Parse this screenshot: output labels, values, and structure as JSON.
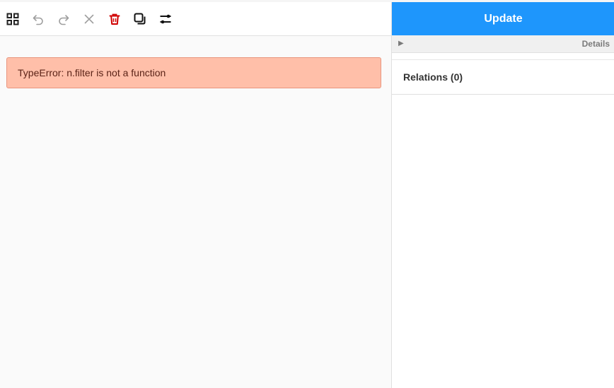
{
  "toolbar": {
    "buttons": [
      {
        "name": "grid-view-icon",
        "color": "#222222"
      },
      {
        "name": "undo-icon",
        "color": "#9e9e9e"
      },
      {
        "name": "redo-icon",
        "color": "#9e9e9e"
      },
      {
        "name": "close-icon",
        "color": "#9e9e9e"
      },
      {
        "name": "delete-icon",
        "color": "#d00000"
      },
      {
        "name": "copy-icon",
        "color": "#111111"
      },
      {
        "name": "toggle-settings-icon",
        "color": "#111111"
      }
    ]
  },
  "main": {
    "error_message": "TypeError: n.filter is not a function"
  },
  "sidebar": {
    "update_label": "Update",
    "details_arrow": "▶",
    "details_label": "Details",
    "relations_label": "Relations (0)"
  },
  "colors": {
    "accent": "#1e96fc",
    "error_bg": "#ffbfa9",
    "error_text": "#5a2317"
  }
}
